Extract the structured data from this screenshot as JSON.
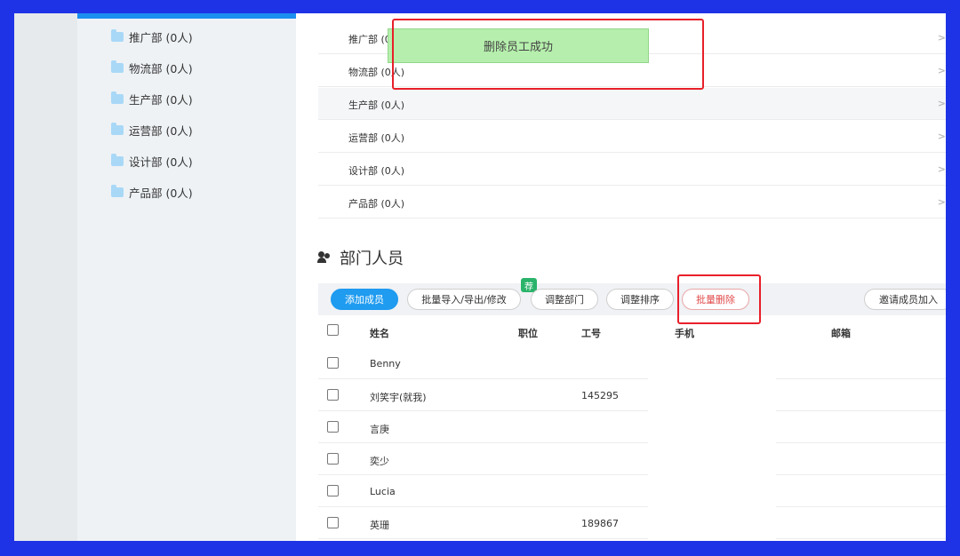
{
  "sidebar": {
    "items": [
      {
        "label": "推广部 (0人)"
      },
      {
        "label": "物流部 (0人)"
      },
      {
        "label": "生产部 (0人)"
      },
      {
        "label": "运营部 (0人)"
      },
      {
        "label": "设计部 (0人)"
      },
      {
        "label": "产品部 (0人)"
      }
    ]
  },
  "subdepartments": [
    {
      "label": "推广部 (0人)"
    },
    {
      "label": "物流部 (0人)"
    },
    {
      "label": "生产部 (0人)"
    },
    {
      "label": "运营部 (0人)"
    },
    {
      "label": "设计部 (0人)"
    },
    {
      "label": "产品部 (0人)"
    }
  ],
  "chevron": ">",
  "toast": {
    "message": "删除员工成功"
  },
  "members_section": {
    "title": "部门人员"
  },
  "toolbar": {
    "add_member": "添加成员",
    "batch_import": "批量导入/导出/修改",
    "recommend_badge": "荐",
    "adjust_department": "调整部门",
    "adjust_order": "调整排序",
    "batch_delete": "批量删除",
    "invite_members": "邀请成员加入"
  },
  "table": {
    "columns": {
      "name": "姓名",
      "position": "职位",
      "employee_id": "工号",
      "phone": "手机",
      "email": "邮箱"
    },
    "rows": [
      {
        "name": "Benny",
        "position": "",
        "employee_id": ""
      },
      {
        "name": "刘笑宇(就我)",
        "position": "",
        "employee_id": "145295"
      },
      {
        "name": "言庚",
        "position": "",
        "employee_id": ""
      },
      {
        "name": "奕少",
        "position": "",
        "employee_id": ""
      },
      {
        "name": "Lucia",
        "position": "",
        "employee_id": ""
      },
      {
        "name": "英珊",
        "position": "",
        "employee_id": "189867"
      }
    ]
  },
  "colors": {
    "background": "#1e33e6",
    "accent": "#1f9bf0",
    "toast": "#b6efad",
    "highlight": "#e8202a"
  }
}
